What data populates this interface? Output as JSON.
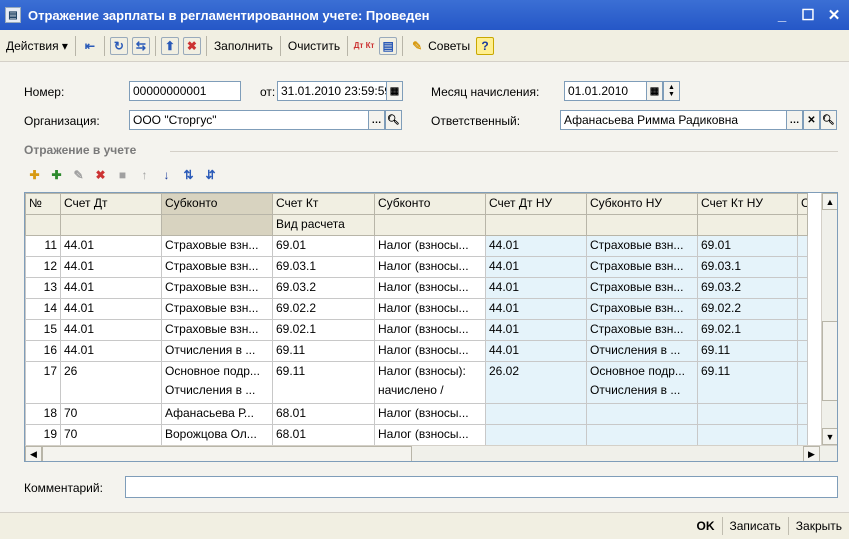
{
  "window": {
    "title": "Отражение зарплаты в регламентированном учете: Проведен"
  },
  "toolbar": {
    "actions_label": "Действия ▾",
    "fill_label": "Заполнить",
    "clear_label": "Очистить",
    "dt_kt_label": "Дт Кт",
    "tips_label": "Советы",
    "help_label": "?"
  },
  "form": {
    "number_label": "Номер:",
    "number_value": "00000000001",
    "date_label": "от:",
    "date_value": "31.01.2010 23:59:59",
    "month_label": "Месяц начисления:",
    "month_value": "01.01.2010",
    "org_label": "Организация:",
    "org_value": "ООО \"Сторгус\"",
    "resp_label": "Ответственный:",
    "resp_value": "Афанасьева Римма Радиковна",
    "section_title": "Отражение в учете",
    "comment_label": "Комментарий:",
    "comment_value": ""
  },
  "grid": {
    "headers": [
      "№",
      "Счет Дт",
      "Субконто",
      "Счет Кт",
      "Субконто",
      "Счет Дт НУ",
      "Субконто НУ",
      "Счет Кт НУ",
      "Су"
    ],
    "subheader": "Вид расчета",
    "rows": [
      {
        "n": "11",
        "dt": "44.01",
        "sub": "Страховые взн...",
        "kt": "69.01",
        "sub2": "Налог (взносы...",
        "dtnu": "44.01",
        "subnu": "Страховые взн...",
        "ktnu": "69.01"
      },
      {
        "n": "12",
        "dt": "44.01",
        "sub": "Страховые взн...",
        "kt": "69.03.1",
        "sub2": "Налог (взносы...",
        "dtnu": "44.01",
        "subnu": "Страховые взн...",
        "ktnu": "69.03.1"
      },
      {
        "n": "13",
        "dt": "44.01",
        "sub": "Страховые взн...",
        "kt": "69.03.2",
        "sub2": "Налог (взносы...",
        "dtnu": "44.01",
        "subnu": "Страховые взн...",
        "ktnu": "69.03.2"
      },
      {
        "n": "14",
        "dt": "44.01",
        "sub": "Страховые взн...",
        "kt": "69.02.2",
        "sub2": "Налог (взносы...",
        "dtnu": "44.01",
        "subnu": "Страховые взн...",
        "ktnu": "69.02.2"
      },
      {
        "n": "15",
        "dt": "44.01",
        "sub": "Страховые взн...",
        "kt": "69.02.1",
        "sub2": "Налог (взносы...",
        "dtnu": "44.01",
        "subnu": "Страховые взн...",
        "ktnu": "69.02.1"
      },
      {
        "n": "16",
        "dt": "44.01",
        "sub": "Отчисления в ...",
        "kt": "69.11",
        "sub2": "Налог (взносы...",
        "dtnu": "44.01",
        "subnu": "Отчисления в ...",
        "ktnu": "69.11"
      },
      {
        "n": "17",
        "dt": "26",
        "sub": "Основное подр...",
        "sub_b": "Отчисления в ...",
        "kt": "69.11",
        "sub2": "Налог (взносы):",
        "sub2_b": "начислено /",
        "dtnu": "26.02",
        "subnu": "Основное подр...",
        "subnu_b": "Отчисления в ...",
        "ktnu": "69.11"
      },
      {
        "n": "18",
        "dt": "70",
        "sub": "Афанасьева Р...",
        "kt": "68.01",
        "sub2": "Налог (взносы...",
        "dtnu": "",
        "subnu": "",
        "ktnu": ""
      },
      {
        "n": "19",
        "dt": "70",
        "sub": "Ворожцова Ол...",
        "kt": "68.01",
        "sub2": "Налог (взносы...",
        "dtnu": "",
        "subnu": "",
        "ktnu": ""
      }
    ]
  },
  "footer": {
    "ok_label": "OK",
    "save_label": "Записать",
    "close_label": "Закрыть"
  }
}
